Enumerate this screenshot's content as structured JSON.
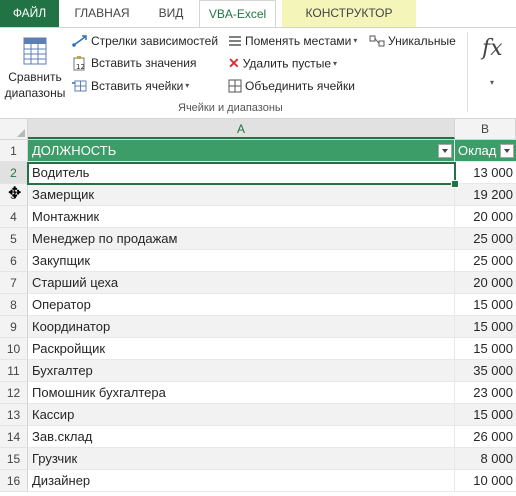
{
  "tabs": {
    "file": "ФАЙЛ",
    "home": "ГЛАВНАЯ",
    "view": "ВИД",
    "vba": "VBA-Excel",
    "constructor": "КОНСТРУКТОР"
  },
  "ribbon": {
    "compare_line1": "Сравнить",
    "compare_line2": "диапазоны",
    "dependency_arrows": "Стрелки зависимостей",
    "insert_values": "Вставить значения",
    "insert_cells": "Вставить ячейки",
    "swap": "Поменять местами",
    "delete_empty": "Удалить пустые",
    "merge_cells": "Объединить ячейки",
    "unique": "Уникальные",
    "fx": "fx",
    "group_label": "Ячейки и диапазоны"
  },
  "grid": {
    "col_a": "A",
    "col_b": "B",
    "header_row_num": "1",
    "header_a": "ДОЛЖНОСТЬ",
    "header_b": "Оклад",
    "rows": [
      {
        "num": "2",
        "position": "Водитель",
        "salary": "13 000"
      },
      {
        "num": "3",
        "position": "Замерщик",
        "salary": "19 200"
      },
      {
        "num": "4",
        "position": "Монтажник",
        "salary": "20 000"
      },
      {
        "num": "5",
        "position": "Менеджер по продажам",
        "salary": "25 000"
      },
      {
        "num": "6",
        "position": "Закупщик",
        "salary": "25 000"
      },
      {
        "num": "7",
        "position": "Старший цеха",
        "salary": "20 000"
      },
      {
        "num": "8",
        "position": "Оператор",
        "salary": "15 000"
      },
      {
        "num": "9",
        "position": "Координатор",
        "salary": "15 000"
      },
      {
        "num": "10",
        "position": "Раскройщик",
        "salary": "15 000"
      },
      {
        "num": "11",
        "position": "Бухгалтер",
        "salary": "35 000"
      },
      {
        "num": "12",
        "position": "Помошник бухгалтера",
        "salary": "23 000"
      },
      {
        "num": "13",
        "position": "Кассир",
        "salary": "15 000"
      },
      {
        "num": "14",
        "position": "Зав.склад",
        "salary": "26 000"
      },
      {
        "num": "15",
        "position": "Грузчик",
        "salary": "8 000"
      },
      {
        "num": "16",
        "position": "Дизайнер",
        "salary": "10 000"
      }
    ]
  },
  "colors": {
    "accent": "#217346",
    "table_header": "#3c9d69",
    "contextual_tab": "#f3f5b9"
  }
}
